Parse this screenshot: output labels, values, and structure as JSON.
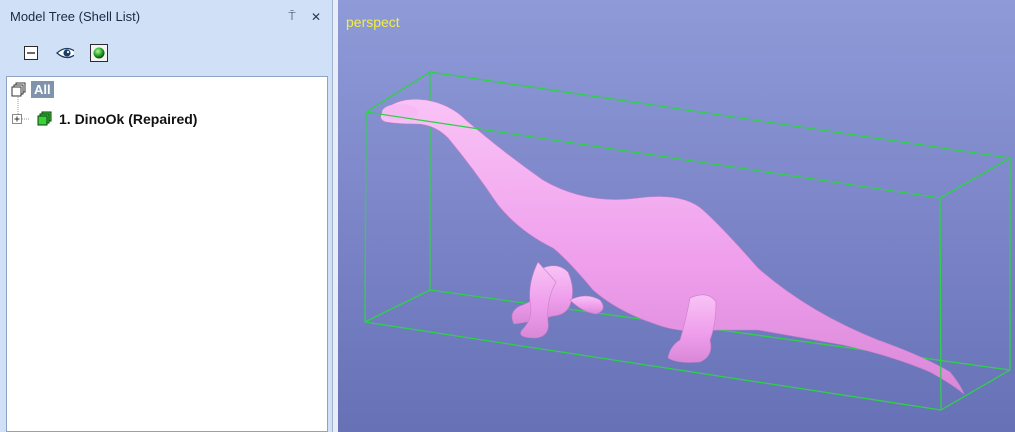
{
  "panel": {
    "title": "Model Tree (Shell List)",
    "pin_glyph": "⍑",
    "close_glyph": "✕"
  },
  "toolbar": {
    "collapse_icon": "collapse-all-icon",
    "visibility_icon": "eye-icon",
    "shaded_icon": "shaded-sphere-icon"
  },
  "tree": {
    "root_label": "All",
    "items": [
      {
        "label": "1. DinoOk (Repaired)"
      }
    ]
  },
  "viewport": {
    "view_name": "perspect"
  },
  "colors": {
    "panel_bg": "#cfe0f7",
    "model": "#f3a6f0",
    "bbox": "#2ed14a",
    "view_label": "#f4ee3c",
    "viewport_top": "#8e9bd8",
    "viewport_bottom": "#6671b6"
  }
}
